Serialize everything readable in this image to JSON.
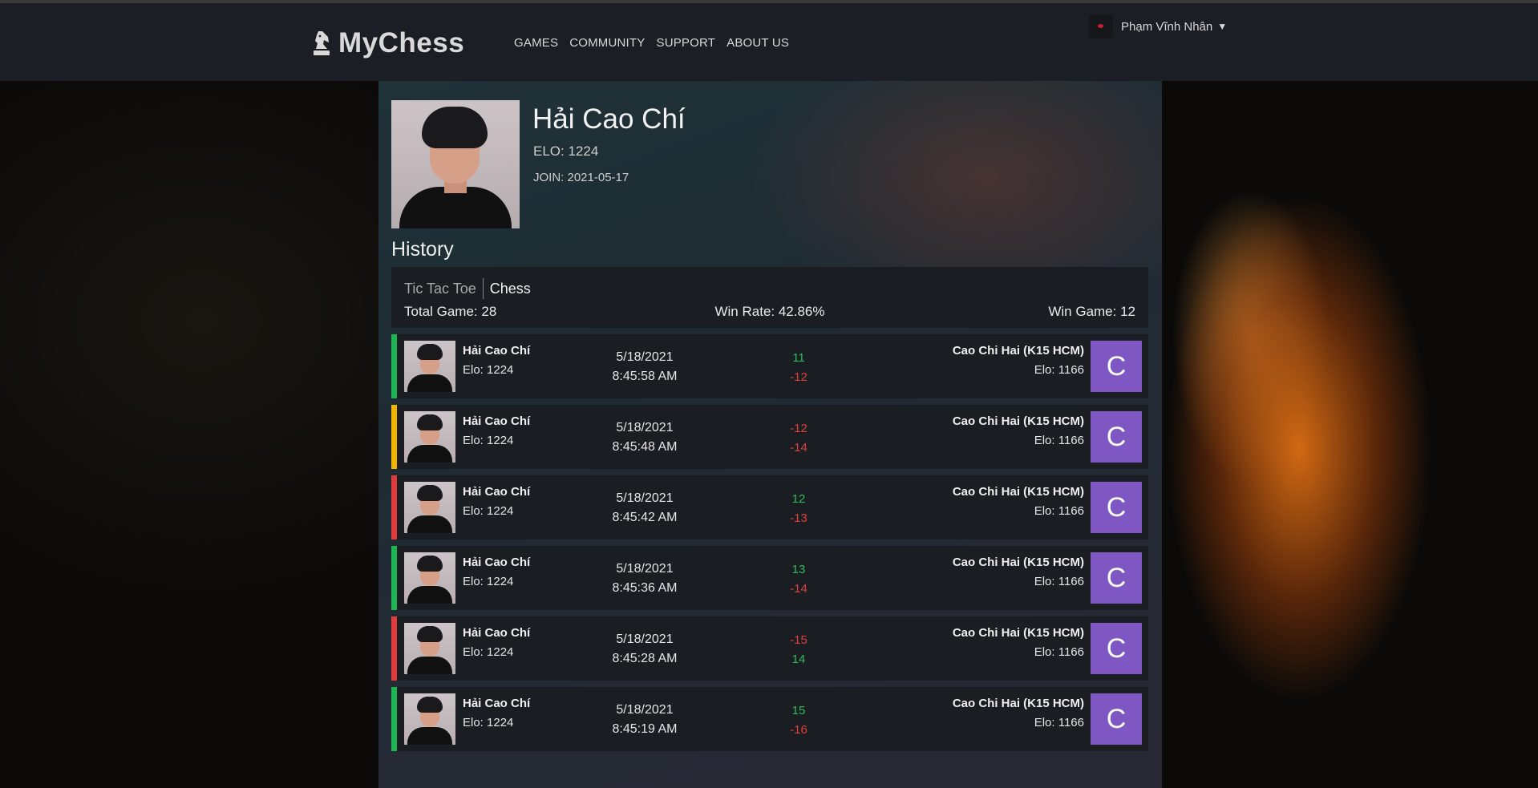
{
  "header": {
    "brand": "MyChess",
    "nav": [
      "GAMES",
      "COMMUNITY",
      "SUPPORT",
      "ABOUT US"
    ],
    "user": {
      "name": "Phạm Vĩnh Nhân",
      "caret": "▼"
    }
  },
  "profile": {
    "name": "Hải Cao Chí",
    "elo": "ELO: 1224",
    "join": "JOIN: 2021-05-17"
  },
  "history": {
    "title": "History",
    "tabs": [
      "Tic Tac Toe",
      "Chess"
    ],
    "active_tab": "Chess",
    "total": "Total Game: 28",
    "win_rate": "Win Rate: 42.86%",
    "win_game": "Win Game: 12"
  },
  "colors": {
    "win": "#1db454",
    "draw": "#f0b400",
    "loss": "#e23b3b",
    "avatar": "#7e57c2"
  },
  "games": [
    {
      "result": "win",
      "p1_name": "Hải Cao Chí",
      "p1_elo": "Elo: 1224",
      "date": "5/18/2021",
      "time": "8:45:58 AM",
      "d1": "11",
      "d2": "-12",
      "p2_name": "Cao Chi Hai (K15 HCM)",
      "p2_elo": "Elo: 1166",
      "p2_initial": "C"
    },
    {
      "result": "draw",
      "p1_name": "Hải Cao Chí",
      "p1_elo": "Elo: 1224",
      "date": "5/18/2021",
      "time": "8:45:48 AM",
      "d1": "-12",
      "d2": "-14",
      "p2_name": "Cao Chi Hai (K15 HCM)",
      "p2_elo": "Elo: 1166",
      "p2_initial": "C"
    },
    {
      "result": "loss",
      "p1_name": "Hải Cao Chí",
      "p1_elo": "Elo: 1224",
      "date": "5/18/2021",
      "time": "8:45:42 AM",
      "d1": "12",
      "d2": "-13",
      "p2_name": "Cao Chi Hai (K15 HCM)",
      "p2_elo": "Elo: 1166",
      "p2_initial": "C"
    },
    {
      "result": "win",
      "p1_name": "Hải Cao Chí",
      "p1_elo": "Elo: 1224",
      "date": "5/18/2021",
      "time": "8:45:36 AM",
      "d1": "13",
      "d2": "-14",
      "p2_name": "Cao Chi Hai (K15 HCM)",
      "p2_elo": "Elo: 1166",
      "p2_initial": "C"
    },
    {
      "result": "loss",
      "p1_name": "Hải Cao Chí",
      "p1_elo": "Elo: 1224",
      "date": "5/18/2021",
      "time": "8:45:28 AM",
      "d1": "-15",
      "d2": "14",
      "p2_name": "Cao Chi Hai (K15 HCM)",
      "p2_elo": "Elo: 1166",
      "p2_initial": "C"
    },
    {
      "result": "win",
      "p1_name": "Hải Cao Chí",
      "p1_elo": "Elo: 1224",
      "date": "5/18/2021",
      "time": "8:45:19 AM",
      "d1": "15",
      "d2": "-16",
      "p2_name": "Cao Chi Hai (K15 HCM)",
      "p2_elo": "Elo: 1166",
      "p2_initial": "C"
    }
  ]
}
